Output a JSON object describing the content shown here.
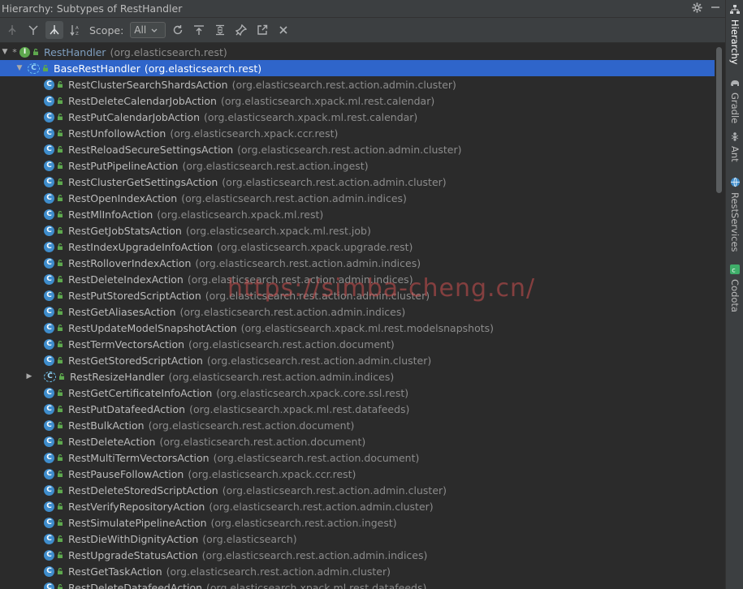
{
  "window": {
    "title": "Hierarchy:  Subtypes of RestHandler"
  },
  "toolbar": {
    "scope_label": "Scope:",
    "scope_value": "All"
  },
  "tree": {
    "root": {
      "name": "RestHandler",
      "pkg": "(org.elasticsearch.rest)"
    },
    "selected": {
      "name": "BaseRestHandler",
      "pkg": "(org.elasticsearch.rest)"
    },
    "children": [
      {
        "name": "RestClusterSearchShardsAction",
        "pkg": "(org.elasticsearch.rest.action.admin.cluster)"
      },
      {
        "name": "RestDeleteCalendarJobAction",
        "pkg": "(org.elasticsearch.xpack.ml.rest.calendar)"
      },
      {
        "name": "RestPutCalendarJobAction",
        "pkg": "(org.elasticsearch.xpack.ml.rest.calendar)"
      },
      {
        "name": "RestUnfollowAction",
        "pkg": "(org.elasticsearch.xpack.ccr.rest)"
      },
      {
        "name": "RestReloadSecureSettingsAction",
        "pkg": "(org.elasticsearch.rest.action.admin.cluster)"
      },
      {
        "name": "RestPutPipelineAction",
        "pkg": "(org.elasticsearch.rest.action.ingest)"
      },
      {
        "name": "RestClusterGetSettingsAction",
        "pkg": "(org.elasticsearch.rest.action.admin.cluster)"
      },
      {
        "name": "RestOpenIndexAction",
        "pkg": "(org.elasticsearch.rest.action.admin.indices)"
      },
      {
        "name": "RestMlInfoAction",
        "pkg": "(org.elasticsearch.xpack.ml.rest)"
      },
      {
        "name": "RestGetJobStatsAction",
        "pkg": "(org.elasticsearch.xpack.ml.rest.job)"
      },
      {
        "name": "RestIndexUpgradeInfoAction",
        "pkg": "(org.elasticsearch.xpack.upgrade.rest)"
      },
      {
        "name": "RestRolloverIndexAction",
        "pkg": "(org.elasticsearch.rest.action.admin.indices)"
      },
      {
        "name": "RestDeleteIndexAction",
        "pkg": "(org.elasticsearch.rest.action.admin.indices)"
      },
      {
        "name": "RestPutStoredScriptAction",
        "pkg": "(org.elasticsearch.rest.action.admin.cluster)"
      },
      {
        "name": "RestGetAliasesAction",
        "pkg": "(org.elasticsearch.rest.action.admin.indices)"
      },
      {
        "name": "RestUpdateModelSnapshotAction",
        "pkg": "(org.elasticsearch.xpack.ml.rest.modelsnapshots)"
      },
      {
        "name": "RestTermVectorsAction",
        "pkg": "(org.elasticsearch.rest.action.document)"
      },
      {
        "name": "RestGetStoredScriptAction",
        "pkg": "(org.elasticsearch.rest.action.admin.cluster)"
      },
      {
        "name": "RestResizeHandler",
        "pkg": "(org.elasticsearch.rest.action.admin.indices)",
        "expandable": true,
        "abstract": true
      },
      {
        "name": "RestGetCertificateInfoAction",
        "pkg": "(org.elasticsearch.xpack.core.ssl.rest)"
      },
      {
        "name": "RestPutDatafeedAction",
        "pkg": "(org.elasticsearch.xpack.ml.rest.datafeeds)"
      },
      {
        "name": "RestBulkAction",
        "pkg": "(org.elasticsearch.rest.action.document)"
      },
      {
        "name": "RestDeleteAction",
        "pkg": "(org.elasticsearch.rest.action.document)"
      },
      {
        "name": "RestMultiTermVectorsAction",
        "pkg": "(org.elasticsearch.rest.action.document)"
      },
      {
        "name": "RestPauseFollowAction",
        "pkg": "(org.elasticsearch.xpack.ccr.rest)"
      },
      {
        "name": "RestDeleteStoredScriptAction",
        "pkg": "(org.elasticsearch.rest.action.admin.cluster)"
      },
      {
        "name": "RestVerifyRepositoryAction",
        "pkg": "(org.elasticsearch.rest.action.admin.cluster)"
      },
      {
        "name": "RestSimulatePipelineAction",
        "pkg": "(org.elasticsearch.rest.action.ingest)"
      },
      {
        "name": "RestDieWithDignityAction",
        "pkg": "(org.elasticsearch)"
      },
      {
        "name": "RestUpgradeStatusAction",
        "pkg": "(org.elasticsearch.rest.action.admin.indices)"
      },
      {
        "name": "RestGetTaskAction",
        "pkg": "(org.elasticsearch.rest.action.admin.cluster)"
      },
      {
        "name": "RestDeleteDatafeedAction",
        "pkg": "(org.elasticsearch.xpack.ml.rest.datafeeds)"
      }
    ]
  },
  "sidebar": {
    "tabs": [
      "Hierarchy",
      "Gradle",
      "Ant",
      "RestServices",
      "Codota"
    ]
  },
  "watermark": "https://simba-cheng.cn/",
  "colors": {
    "background": "#2b2b2b",
    "panel": "#3c3f41",
    "selection": "#2f65ca",
    "class_icon": "#3f8dcc",
    "interface_icon": "#5ea94e"
  }
}
